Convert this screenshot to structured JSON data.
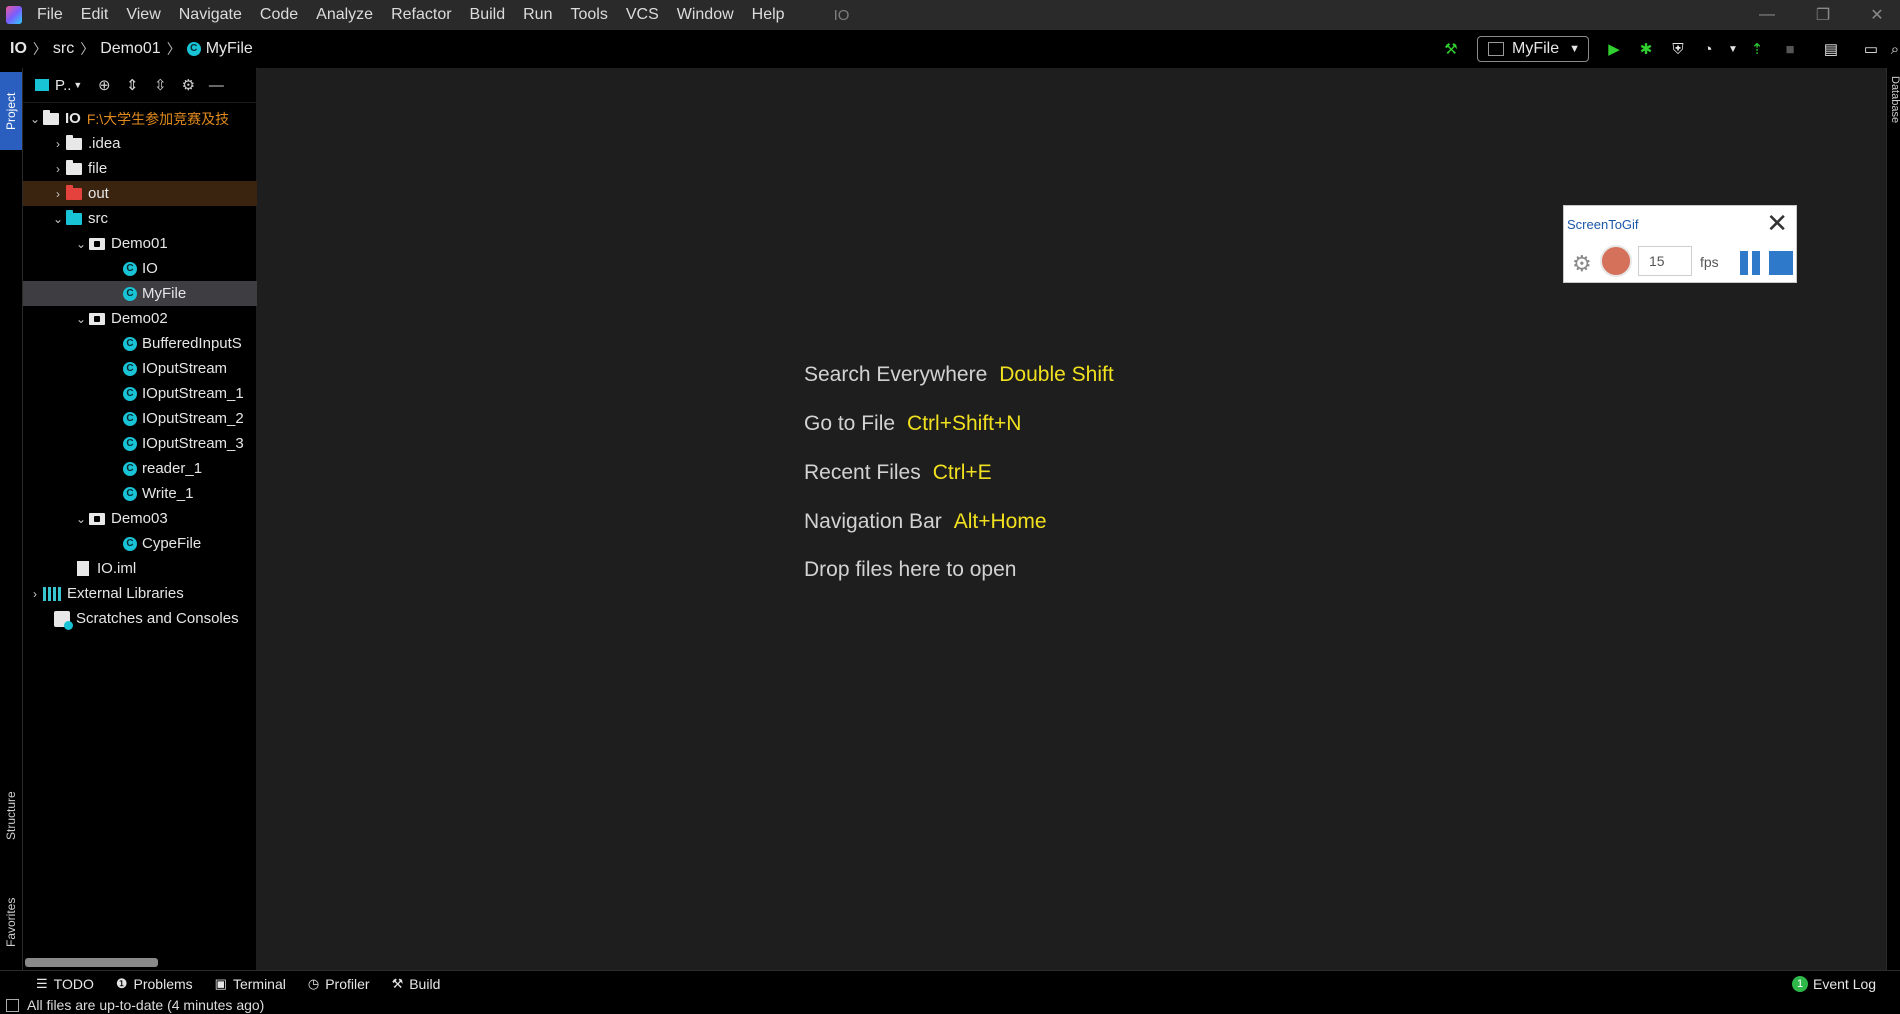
{
  "menubar": {
    "items": [
      "File",
      "Edit",
      "View",
      "Navigate",
      "Code",
      "Analyze",
      "Refactor",
      "Build",
      "Run",
      "Tools",
      "VCS",
      "Window",
      "Help"
    ],
    "window_title": "IO"
  },
  "window_controls": {
    "minimize": "—",
    "restore": "❐",
    "close": "✕"
  },
  "navbar": {
    "breadcrumbs": [
      "IO",
      "src",
      "Demo01",
      "MyFile"
    ],
    "run_config": "MyFile"
  },
  "toolbar_icons": [
    "hammer-icon",
    "run-icon",
    "debug-icon",
    "coverage-icon",
    "profile-icon",
    "attach-icon",
    "stop-icon",
    "project-structure-icon",
    "terminal-icon",
    "search-icon"
  ],
  "left_stripe": {
    "project": "Project",
    "structure": "Structure",
    "favorites": "Favorites"
  },
  "right_stripe": {
    "database": "Database"
  },
  "project_panel": {
    "view_label": "P..",
    "tree": {
      "root_label": "IO",
      "root_path": "F:\\大学生参加竞赛及技",
      "idea": ".idea",
      "file": "file",
      "out": "out",
      "src": "src",
      "demo01": "Demo01",
      "demo01_io": "IO",
      "demo01_myfile": "MyFile",
      "demo02": "Demo02",
      "buffered": "BufferedInputS",
      "ioputstream": "IOputStream",
      "ioputstream1": "IOputStream_1",
      "ioputstream2": "IOputStream_2",
      "ioputstream3": "IOputStream_3",
      "reader1": "reader_1",
      "write1": "Write_1",
      "demo03": "Demo03",
      "cypefile": "CypeFile",
      "ioiml": "IO.iml",
      "external": "External Libraries",
      "scratches": "Scratches and Consoles"
    }
  },
  "editor_hints": [
    {
      "label": "Search Everywhere",
      "key": "Double Shift"
    },
    {
      "label": "Go to File",
      "key": "Ctrl+Shift+N"
    },
    {
      "label": "Recent Files",
      "key": "Ctrl+E"
    },
    {
      "label": "Navigation Bar",
      "key": "Alt+Home"
    },
    {
      "label": "Drop files here to open",
      "key": ""
    }
  ],
  "bottom_tabs": {
    "todo": "TODO",
    "problems": "Problems",
    "terminal": "Terminal",
    "profiler": "Profiler",
    "build": "Build",
    "event_log": "Event Log",
    "event_count": "1"
  },
  "status": {
    "message": "All files are up-to-date (4 minutes ago)"
  },
  "screentogif": {
    "title": "ScreenToGif",
    "fps_value": "15",
    "fps_label": "fps"
  },
  "colors": {
    "accent_yellow": "#f0e01f",
    "class_cyan": "#19c3d6",
    "path_orange": "#e08a1e",
    "out_folder_red": "#e5413d",
    "run_green": "#2fd02f"
  }
}
